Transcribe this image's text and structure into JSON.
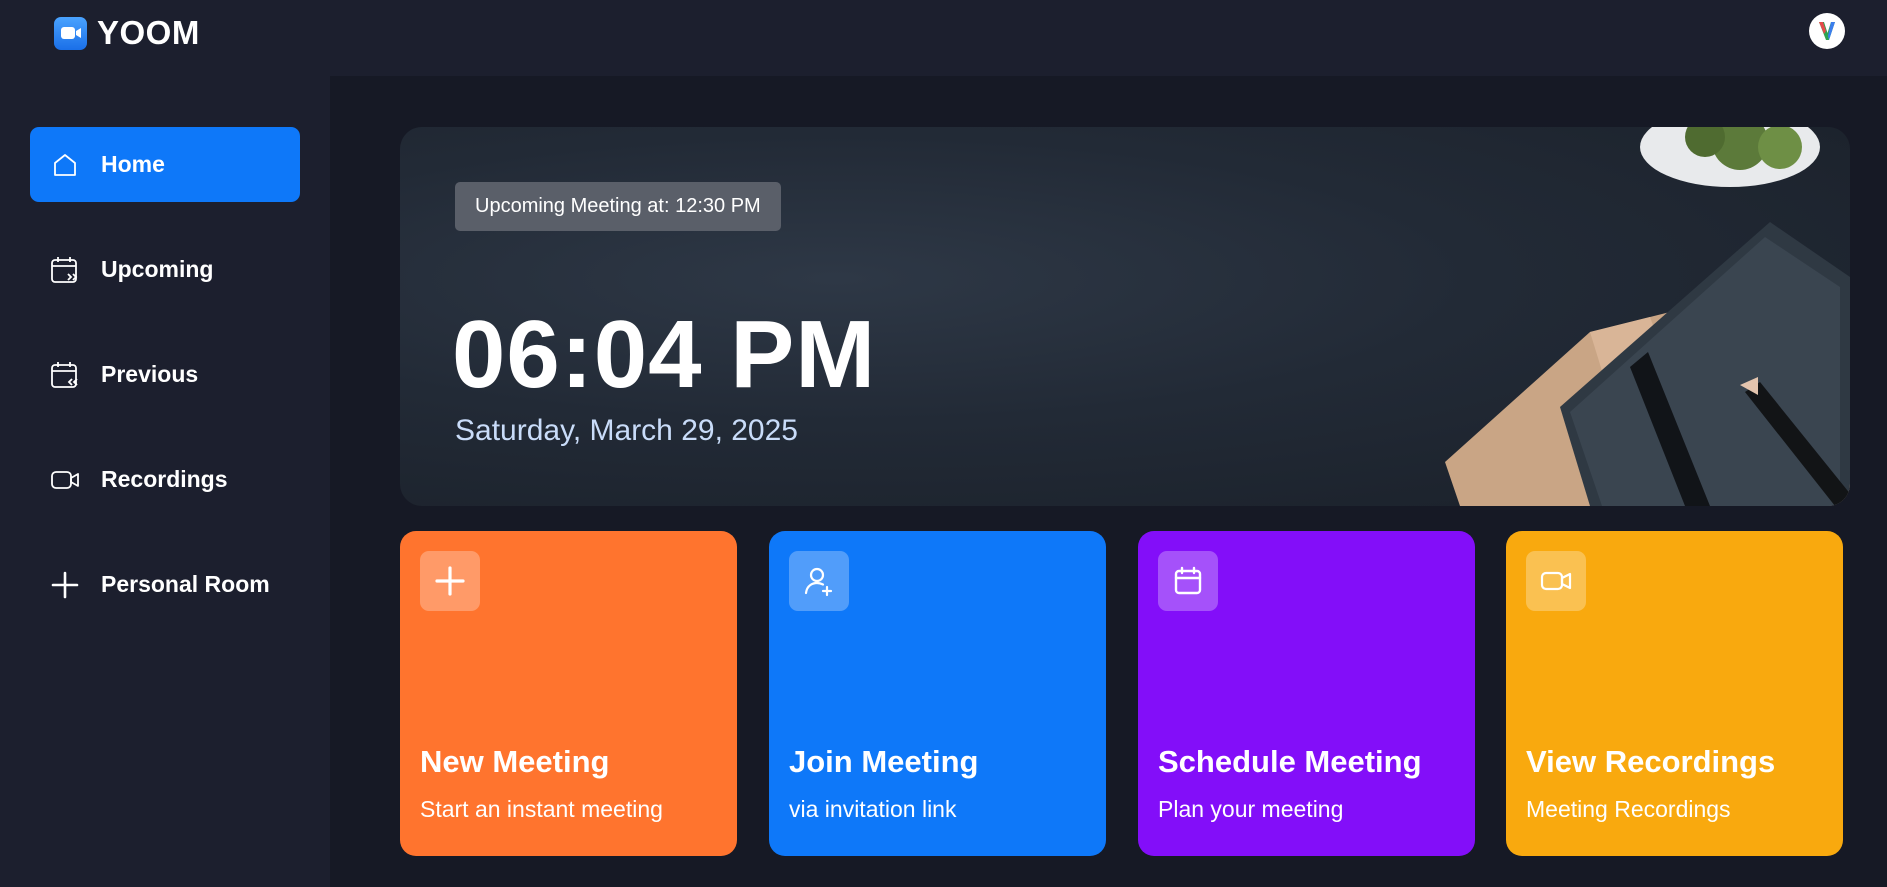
{
  "app": {
    "name": "YOOM"
  },
  "sidebar": {
    "items": [
      {
        "label": "Home",
        "icon": "home-icon"
      },
      {
        "label": "Upcoming",
        "icon": "calendar-upcoming-icon"
      },
      {
        "label": "Previous",
        "icon": "calendar-previous-icon"
      },
      {
        "label": "Recordings",
        "icon": "video-icon"
      },
      {
        "label": "Personal Room",
        "icon": "plus-icon"
      }
    ]
  },
  "hero": {
    "badge": "Upcoming Meeting at: 12:30 PM",
    "time": "06:04 PM",
    "date": "Saturday, March 29, 2025"
  },
  "cards": [
    {
      "title": "New Meeting",
      "subtitle": "Start an instant meeting",
      "icon": "plus-icon",
      "color": "#ff742e"
    },
    {
      "title": "Join Meeting",
      "subtitle": "via invitation link",
      "icon": "add-user-icon",
      "color": "#0e78f9"
    },
    {
      "title": "Schedule Meeting",
      "subtitle": "Plan your meeting",
      "icon": "calendar-icon",
      "color": "#830ef9"
    },
    {
      "title": "View Recordings",
      "subtitle": "Meeting Recordings",
      "icon": "video-icon",
      "color": "#f9a90e"
    }
  ],
  "colors": {
    "background": "#161925",
    "panel": "#1c1f2e",
    "accent": "#0e78f9"
  }
}
